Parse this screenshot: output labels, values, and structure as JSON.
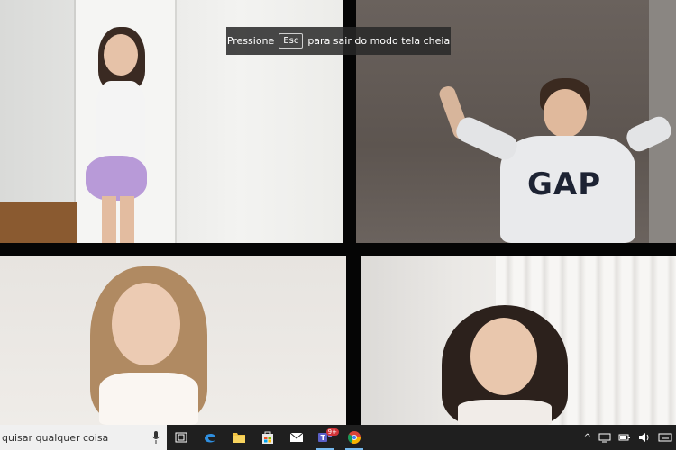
{
  "toast": {
    "prefix": "Pressione",
    "key": "Esc",
    "suffix": "para sair do modo tela cheia"
  },
  "video_tiles": [
    {
      "id": "tile-1"
    },
    {
      "id": "tile-2",
      "shirt_text": "GAP"
    },
    {
      "id": "tile-3"
    },
    {
      "id": "tile-4"
    }
  ],
  "taskbar": {
    "search_placeholder": "quisar qualquer coisa",
    "icons": [
      "task-view-icon",
      "edge-icon",
      "file-explorer-icon",
      "store-icon",
      "mail-icon",
      "teams-icon",
      "chrome-icon"
    ],
    "teams_badge": "9+"
  },
  "colors": {
    "taskbar_bg": "#1f1f1f",
    "search_bg": "#f0f0f0",
    "active_indicator": "#76b9ed",
    "toast_bg": "#282828"
  }
}
